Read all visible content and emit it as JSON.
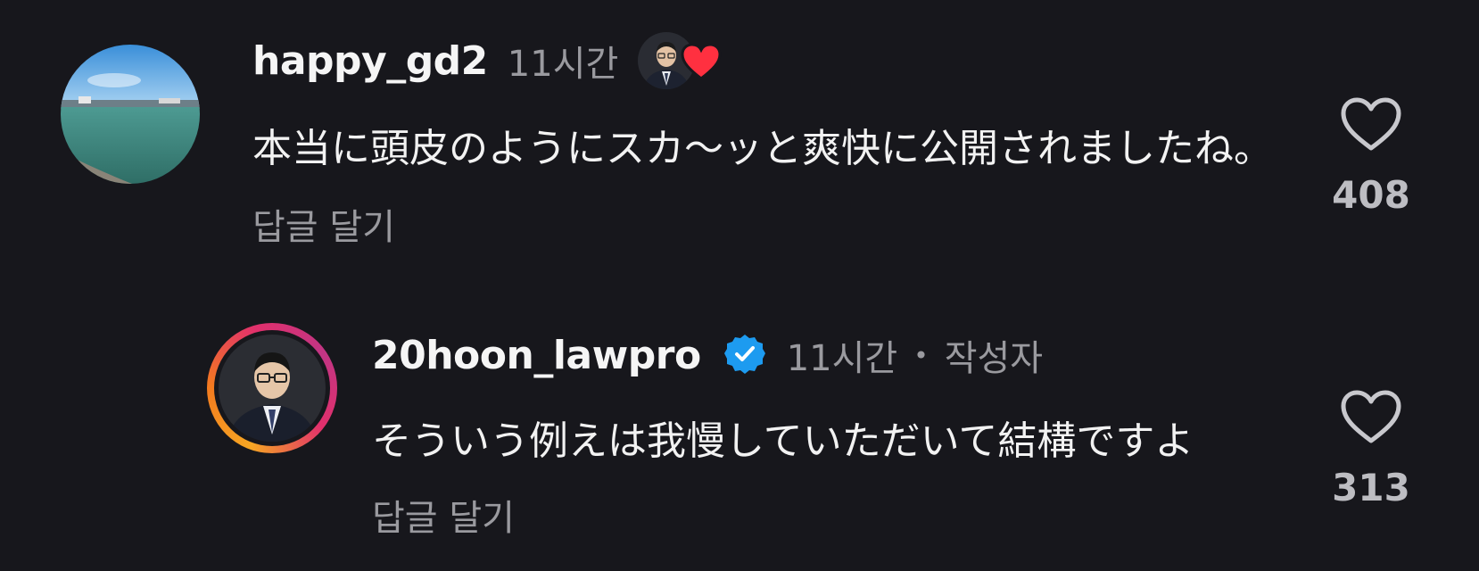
{
  "comments": [
    {
      "username": "happy_gd2",
      "time": "11시간",
      "text": "本当に頭皮のようにスカ〜ッと爽快に公開されましたね。",
      "reply_label": "답글 달기",
      "like_count": "408",
      "liked_by_author": true,
      "avatar_icon": "landscape-avatar"
    },
    {
      "username": "20hoon_lawpro",
      "verified": true,
      "time": "11시간",
      "separator": "•",
      "author_label": "작성자",
      "text": "そういう例えは我慢していただいて結構ですよ",
      "reply_label": "답글 달기",
      "like_count": "313",
      "avatar_icon": "person-avatar",
      "story_ring": true
    }
  ],
  "colors": {
    "background": "#17171c",
    "primary_text": "#f2f2f2",
    "secondary_text": "#9a9a9f",
    "heart_red": "#ff3040",
    "verified_blue": "#1d9bf0"
  }
}
